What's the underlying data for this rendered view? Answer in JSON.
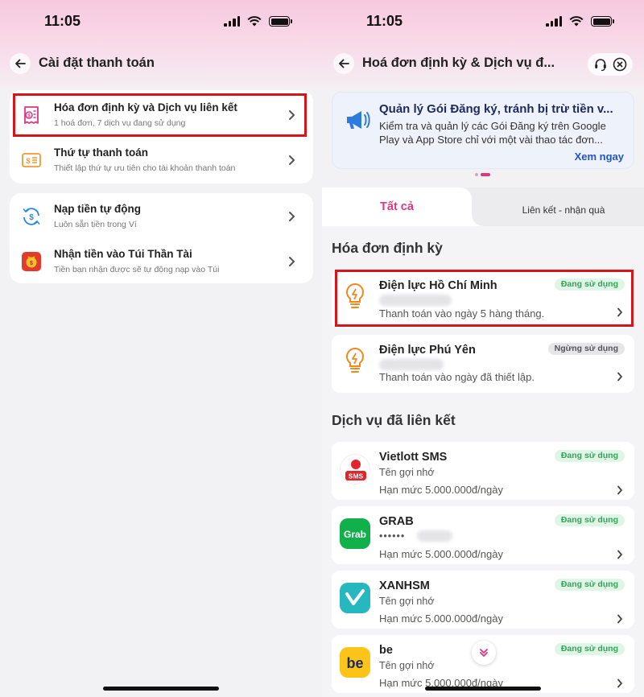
{
  "left": {
    "status": {
      "time": "11:05"
    },
    "nav": {
      "title": "Cài đặt thanh toán"
    },
    "group1": [
      {
        "title": "Hóa đơn định kỳ và Dịch vụ liên kết",
        "subtitle": "1 hoá đơn, 7 dịch vụ đang sử dụng"
      },
      {
        "title": "Thứ tự thanh toán",
        "subtitle": "Thiết lập thứ tự ưu tiên cho tài khoản thanh toán"
      }
    ],
    "group2": [
      {
        "title": "Nạp tiền tự động",
        "subtitle": "Luôn sẵn tiền trong Ví"
      },
      {
        "title": "Nhận tiền vào Túi Thần Tài",
        "subtitle": "Tiền bạn nhận được sẽ tự động nạp vào Túi"
      }
    ]
  },
  "right": {
    "status": {
      "time": "11:05"
    },
    "nav": {
      "title": "Hoá đơn định kỳ & Dịch vụ đ..."
    },
    "banner": {
      "title": "Quản lý Gói Đăng ký, tránh bị trừ tiền v...",
      "desc": "Kiểm tra và quản lý các Gói Đăng ký trên Google Play và App Store chỉ với một vài thao tác đơn...",
      "link": "Xem ngay"
    },
    "tabs": {
      "all": "Tất cả",
      "linked": "Liên kết - nhận quà"
    },
    "bills_title": "Hóa đơn định kỳ",
    "bills": [
      {
        "name": "Điện lực Hồ Chí Minh",
        "status": "Đang sử dụng",
        "info": "Thanh toán vào ngày 5 hàng tháng."
      },
      {
        "name": "Điện lực Phú Yên",
        "status": "Ngừng sử dụng",
        "info": "Thanh toán vào ngày đã thiết lập."
      }
    ],
    "services_title": "Dịch vụ đã liên kết",
    "services": [
      {
        "name": "Vietlott SMS",
        "sub": "Tên gợi nhớ",
        "limit": "Hạn mức 5.000.000đ/ngày",
        "status": "Đang sử dụng",
        "logo_text": "SMS"
      },
      {
        "name": "GRAB",
        "sub": "••••••",
        "limit": "Hạn mức 5.000.000đ/ngày",
        "status": "Đang sử dụng",
        "logo_text": "Grab"
      },
      {
        "name": "XANHSM",
        "sub": "Tên gợi nhớ",
        "limit": "Hạn mức 5.000.000đ/ngày",
        "status": "Đang sử dụng"
      },
      {
        "name": "be",
        "sub": "Tên gợi nhớ",
        "limit": "Hạn mức 5.000.000đ/ngày",
        "status": "Đang sử dụng",
        "logo_text": "be"
      }
    ]
  },
  "colors": {
    "accent": "#e0357f",
    "highlight": "#d7141a",
    "link": "#2155c7",
    "active_green": "#34a35a"
  },
  "icons": [
    "back-arrow-icon",
    "receipt-icon",
    "payment-order-icon",
    "auto-topup-icon",
    "lucky-bag-icon",
    "chevron-right-icon",
    "support-icon",
    "close-icon",
    "megaphone-icon",
    "bulb-icon",
    "chevron-down-icon"
  ]
}
